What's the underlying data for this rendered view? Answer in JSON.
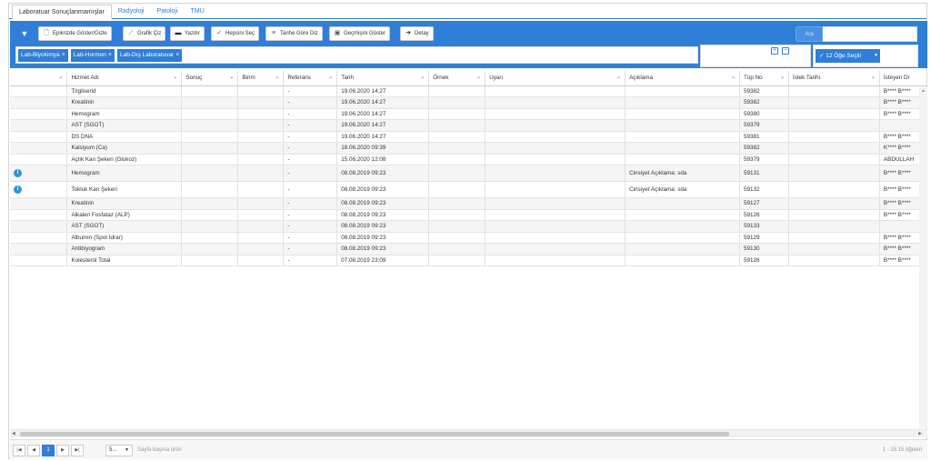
{
  "tabs": [
    "Laboratuar Sonuçlanmamışlar",
    "Radyoloji",
    "Patoloji",
    "TMU"
  ],
  "toolbar": {
    "buttons": [
      {
        "label": "Epikrizde Göster/Gizle",
        "icon": "document-icon"
      },
      {
        "label": "Grafik Çiz",
        "icon": "chart-icon"
      },
      {
        "label": "Yazdır",
        "icon": "print-icon"
      },
      {
        "label": "Hepsini Seç",
        "icon": "check-icon"
      },
      {
        "label": "Tarihe Göre Diz",
        "icon": "sort-icon"
      },
      {
        "label": "Geçmişini Göster",
        "icon": "history-icon"
      },
      {
        "label": "Detay",
        "icon": "arrow-circle-icon"
      }
    ],
    "search_label": "Ara",
    "search_value": "",
    "tags": [
      "Lab-Biyokimya",
      "Lab-Hormon",
      "Lab-Dış Laboratuvar"
    ],
    "selected_label": "12 Öğe Seçili"
  },
  "grid": {
    "columns": [
      "",
      "Hizmet Adı",
      "Sonuç",
      "Birim",
      "Referans",
      "Tarih",
      "Örnek",
      "Uyarı",
      "Açıklama",
      "Tüp No",
      "İstek Tarihi",
      "İsteyen Dr"
    ],
    "rows": [
      {
        "info": false,
        "cells": [
          "Trigliserid",
          "",
          "",
          "-",
          "19.06.2020 14:27",
          "",
          "",
          "",
          "59382",
          "",
          "B**** B****"
        ]
      },
      {
        "info": false,
        "cells": [
          "Kreatinin",
          "",
          "",
          "-",
          "19.06.2020 14:27",
          "",
          "",
          "",
          "59382",
          "",
          "B**** B****"
        ]
      },
      {
        "info": false,
        "cells": [
          "Hemogram",
          "",
          "",
          "-",
          "19.06.2020 14:27",
          "",
          "",
          "",
          "59380",
          "",
          "B**** B****"
        ]
      },
      {
        "info": false,
        "cells": [
          "AST (SGOT)",
          "",
          "",
          "-",
          "19.06.2020 14:27",
          "",
          "",
          "",
          "59379",
          "",
          ""
        ]
      },
      {
        "info": false,
        "cells": [
          "DS DNA",
          "",
          "",
          "-",
          "19.06.2020 14:27",
          "",
          "",
          "",
          "59381",
          "",
          "B**** B****"
        ]
      },
      {
        "info": false,
        "cells": [
          "Kalsiyum (Ca)",
          "",
          "",
          "-",
          "18.06.2020 09:39",
          "",
          "",
          "",
          "59382",
          "",
          "K**** B****"
        ]
      },
      {
        "info": false,
        "cells": [
          "Açlık Kan Şekeri (Glukoz)",
          "",
          "",
          "-",
          "15.06.2020 12:08",
          "",
          "",
          "",
          "59379",
          "",
          "ABDULLAH"
        ]
      },
      {
        "info": true,
        "cells": [
          "Hemogram",
          "",
          "",
          "-",
          "08.08.2019 09:23",
          "",
          "",
          "Cinsiyet Açıklama: sda",
          "59131",
          "",
          "B**** B****"
        ]
      },
      {
        "info": true,
        "cells": [
          "Tokluk Kan Şekeri",
          "",
          "",
          "-",
          "08.08.2019 09:23",
          "",
          "",
          "Cinsiyet Açıklama: sda",
          "59132",
          "",
          "B**** B****"
        ]
      },
      {
        "info": false,
        "cells": [
          "Kreatinin",
          "",
          "",
          "-",
          "08.08.2019 09:23",
          "",
          "",
          "",
          "59127",
          "",
          "B**** B****"
        ]
      },
      {
        "info": false,
        "cells": [
          "Alkalen Fosfataz (ALP)",
          "",
          "",
          "-",
          "08.08.2019 09:23",
          "",
          "",
          "",
          "59126",
          "",
          "B**** B****"
        ]
      },
      {
        "info": false,
        "cells": [
          "AST (SGOT)",
          "",
          "",
          "-",
          "08.08.2019 09:23",
          "",
          "",
          "",
          "59133",
          "",
          ""
        ]
      },
      {
        "info": false,
        "cells": [
          "Albumin (Spot İdrar)",
          "",
          "",
          "-",
          "08.08.2019 09:23",
          "",
          "",
          "",
          "59129",
          "",
          "B**** B****"
        ]
      },
      {
        "info": false,
        "cells": [
          "Antibiyogram",
          "",
          "",
          "-",
          "08.08.2019 09:23",
          "",
          "",
          "",
          "59130",
          "",
          "B**** B****"
        ]
      },
      {
        "info": false,
        "cells": [
          "Kolesterol Total",
          "",
          "",
          "-",
          "07.08.2019 23:09",
          "",
          "",
          "",
          "59126",
          "",
          "B**** B****"
        ]
      }
    ]
  },
  "pager": {
    "current_page": "1",
    "page_size": "5...",
    "page_size_label": "Sayfa başına ürün",
    "info": "1 - 15 15 öğeleri"
  },
  "colors": {
    "accent": "#2f7ed8",
    "info": "#2f95dc"
  }
}
